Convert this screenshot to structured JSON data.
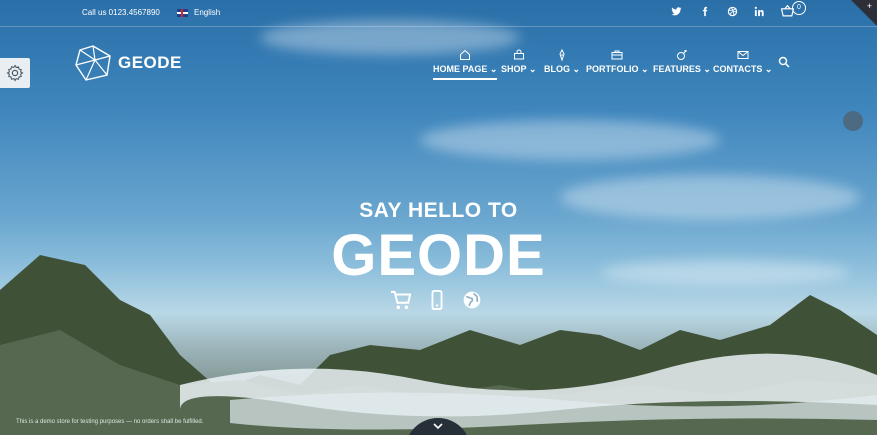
{
  "topbar": {
    "call": "Call us 0123.4567890",
    "language": "English",
    "social": [
      "twitter-icon",
      "facebook-icon",
      "dribbble-icon",
      "linkedin-icon"
    ],
    "cart_count": "0"
  },
  "header": {
    "brand": "GEODE",
    "nav": [
      {
        "label": "HOME PAGE",
        "icon": "home-icon"
      },
      {
        "label": "SHOP",
        "icon": "shop-icon"
      },
      {
        "label": "BLOG",
        "icon": "pen-icon"
      },
      {
        "label": "PORTFOLIO",
        "icon": "briefcase-icon"
      },
      {
        "label": "FEATURES",
        "icon": "sparkle-icon"
      },
      {
        "label": "CONTACTS",
        "icon": "envelope-icon"
      }
    ]
  },
  "hero": {
    "kicker": "SAY HELLO TO",
    "title": "GEODE",
    "icons": [
      "cart-icon",
      "mobile-icon",
      "globe-icon"
    ]
  },
  "footer": {
    "demo_notice": "This is a demo store for testing purposes — no orders shall be fulfilled."
  },
  "colors": {
    "accent": "#ffffff",
    "sky_top": "#2a6fa8",
    "dark": "#273038"
  }
}
